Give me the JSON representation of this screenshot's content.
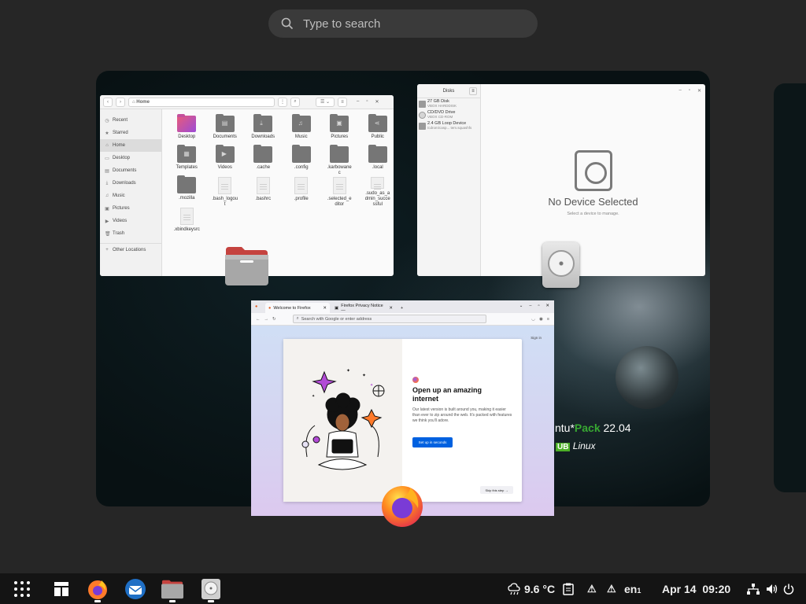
{
  "search": {
    "placeholder": "Type to search"
  },
  "files_window": {
    "path": "Home",
    "sidebar": [
      {
        "icon": "clock-icon",
        "glyph": "◷",
        "label": "Recent"
      },
      {
        "icon": "star-icon",
        "glyph": "★",
        "label": "Starred"
      },
      {
        "icon": "home-icon",
        "glyph": "⌂",
        "label": "Home",
        "selected": true
      },
      {
        "icon": "desktop-icon",
        "glyph": "▭",
        "label": "Desktop"
      },
      {
        "icon": "document-icon",
        "glyph": "▤",
        "label": "Documents"
      },
      {
        "icon": "download-icon",
        "glyph": "⤓",
        "label": "Downloads"
      },
      {
        "icon": "music-icon",
        "glyph": "♫",
        "label": "Music"
      },
      {
        "icon": "picture-icon",
        "glyph": "▣",
        "label": "Pictures"
      },
      {
        "icon": "video-icon",
        "glyph": "▶",
        "label": "Videos"
      },
      {
        "icon": "trash-icon",
        "glyph": "🗑",
        "label": "Trash"
      },
      {
        "icon": "plus-icon",
        "glyph": "+",
        "label": "Other Locations"
      }
    ],
    "items": [
      {
        "label": "Desktop",
        "kind": "desk"
      },
      {
        "label": "Documents",
        "kind": "folder",
        "glyph": "▤"
      },
      {
        "label": "Downloads",
        "kind": "folder",
        "glyph": "⤓"
      },
      {
        "label": "Music",
        "kind": "folder",
        "glyph": "♫"
      },
      {
        "label": "Pictures",
        "kind": "folder",
        "glyph": "▣"
      },
      {
        "label": "Public",
        "kind": "folder",
        "glyph": "⋖"
      },
      {
        "label": "Templates",
        "kind": "folder",
        "glyph": "▦"
      },
      {
        "label": "Videos",
        "kind": "folder",
        "glyph": "▶"
      },
      {
        "label": ".cache",
        "kind": "folder"
      },
      {
        "label": ".config",
        "kind": "folder"
      },
      {
        "label": ".karbowanec",
        "kind": "folder"
      },
      {
        "label": ".local",
        "kind": "folder"
      },
      {
        "label": ".mozilla",
        "kind": "folder"
      },
      {
        "label": ".bash_logout",
        "kind": "doc"
      },
      {
        "label": ".bashrc",
        "kind": "doc"
      },
      {
        "label": ".profile",
        "kind": "doc"
      },
      {
        "label": ".selected_editor",
        "kind": "doc"
      },
      {
        "label": ".sudo_as_admin_successful",
        "kind": "doc"
      },
      {
        "label": ".xbindkeysrc",
        "kind": "doc"
      }
    ]
  },
  "disks_window": {
    "title": "Disks",
    "devices": [
      {
        "name": "27 GB Disk",
        "sub": "VBOX HARDDISK",
        "kind": "hdd"
      },
      {
        "name": "CD/DVD Drive",
        "sub": "VBOX CD-ROM",
        "kind": "cd"
      },
      {
        "name": "2.4 GB Loop Device",
        "sub": "/cdrom/casp... tem.squashfs",
        "kind": "hdd"
      }
    ],
    "empty_title": "No Device Selected",
    "empty_sub": "Select a device to manage."
  },
  "firefox_window": {
    "tabs": [
      "Welcome to Firefox",
      "Firefox Privacy Notice —"
    ],
    "url_placeholder": "Search with Google or enter address",
    "sign_in": "Sign in",
    "heading": "Open up an amazing internet",
    "body": "Our latest version is built around you, making it easier than ever to zip around the web. It's packed with features we think you'll adore.",
    "cta": "Set up in seconds",
    "skip": "Skip this step →"
  },
  "wallpaper": {
    "brand_prefix": "ntu",
    "brand_star": "*",
    "brand_pack": "Pack",
    "brand_version": "22.04",
    "brand_logo": "UB",
    "brand_linux": "Linux"
  },
  "taskbar": {
    "apps": [
      "show-apps-icon",
      "layout-icon",
      "firefox-icon",
      "thunderbird-icon",
      "files-icon",
      "disks-icon"
    ],
    "weather": "9.6 °C",
    "keyboard": "en",
    "keyboard_sub": "1",
    "date": "Apr 14",
    "time": "09:20"
  },
  "colors": {
    "accent": "#0061e0",
    "taskbar": "#141414",
    "brand_green": "#38a832"
  }
}
